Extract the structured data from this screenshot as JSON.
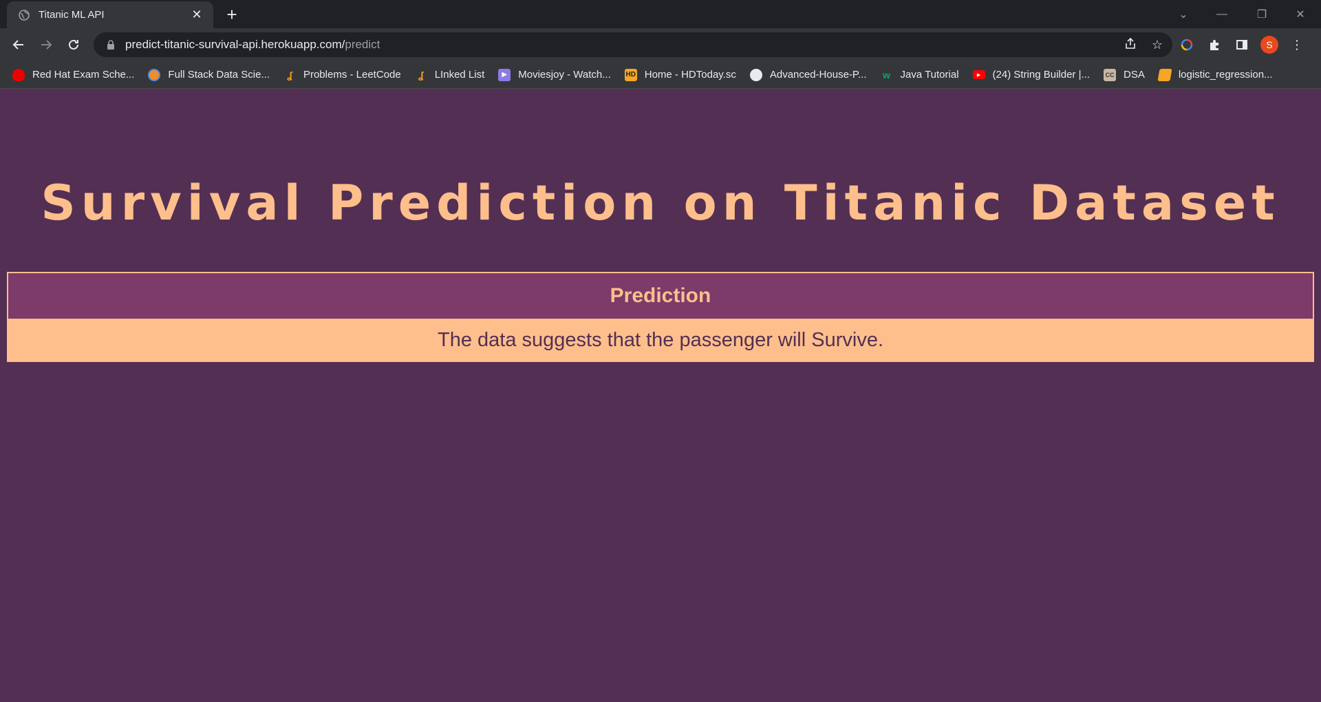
{
  "browser": {
    "tab_title": "Titanic ML API",
    "url_host": "predict-titanic-survival-api.herokuapp.com/",
    "url_path": "predict",
    "avatar_letter": "S",
    "bookmarks": [
      {
        "label": "Red Hat Exam Sche...",
        "icon": "redhat-icon",
        "color": "#e00"
      },
      {
        "label": "Full Stack Data Scie...",
        "icon": "orange-circle-icon",
        "color": "#f28c28"
      },
      {
        "label": "Problems - LeetCode",
        "icon": "leetcode-icon",
        "color": "#ffa116"
      },
      {
        "label": "LInked List",
        "icon": "leetcode-icon",
        "color": "#ffa116"
      },
      {
        "label": "Moviesjoy - Watch...",
        "icon": "moviesjoy-icon",
        "color": "#8c7ae6"
      },
      {
        "label": "Home - HDToday.sc",
        "icon": "hd-icon",
        "color": "#f5a623"
      },
      {
        "label": "Advanced-House-P...",
        "icon": "github-icon",
        "color": "#e8eaed"
      },
      {
        "label": "Java Tutorial",
        "icon": "w3schools-icon",
        "color": "#04aa6d"
      },
      {
        "label": "(24) String Builder |...",
        "icon": "youtube-icon",
        "color": "#ff0000"
      },
      {
        "label": "DSA",
        "icon": "cc-icon",
        "color": "#c8b8a0"
      },
      {
        "label": "logistic_regression...",
        "icon": "book-icon",
        "color": "#f5a623"
      }
    ]
  },
  "page": {
    "heading": "Survival Prediction on Titanic Dataset",
    "table_header": "Prediction",
    "prediction_text": "The data suggests that the passenger will Survive."
  },
  "colors": {
    "background": "#532f53",
    "accent": "#ffbf8c",
    "header_bg": "#7c3b68"
  }
}
